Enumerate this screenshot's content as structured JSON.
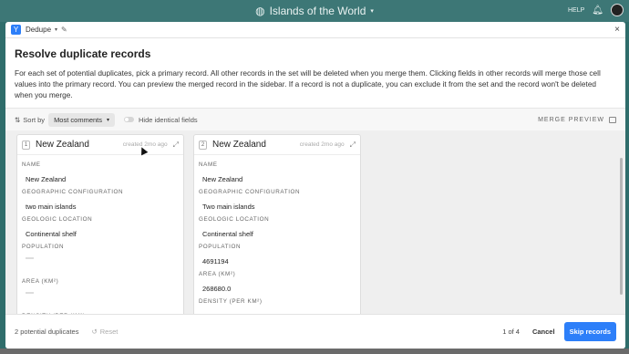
{
  "app": {
    "base_title": "Islands of the World",
    "help_label": "HELP",
    "icons": {
      "globe": "globe-icon",
      "bell": "bell-icon",
      "avatar": "avatar"
    }
  },
  "modal": {
    "app_name": "Dedupe",
    "caret": "▾",
    "close": "×",
    "title": "Resolve duplicate records",
    "description": "For each set of potential duplicates, pick a primary record. All other records in the set will be deleted when you merge them. Clicking fields in other records will merge those cell values into the primary record. You can preview the merged record in the sidebar. If a record is not a duplicate, you can exclude it from the set and the record won't be deleted when you merge."
  },
  "toolbar": {
    "sort_label": "Sort by",
    "sort_value": "Most comments",
    "hide_identical": "Hide identical fields",
    "merge_preview": "MERGE PREVIEW"
  },
  "records": [
    {
      "index": "1",
      "name": "New Zealand",
      "created": "created 2mo ago",
      "fields": [
        {
          "label": "NAME",
          "value": "New Zealand"
        },
        {
          "label": "GEOGRAPHIC CONFIGURATION",
          "value": "two main islands"
        },
        {
          "label": "GEOLOGIC LOCATION",
          "value": "Continental shelf"
        },
        {
          "label": "POPULATION",
          "value": ""
        },
        {
          "label": "AREA (KM²)",
          "value": ""
        },
        {
          "label": "DENSITY (PER KM²)",
          "value": ""
        }
      ]
    },
    {
      "index": "2",
      "name": "New Zealand",
      "created": "created 2mo ago",
      "fields": [
        {
          "label": "NAME",
          "value": "New Zealand"
        },
        {
          "label": "GEOGRAPHIC CONFIGURATION",
          "value": "Two main islands"
        },
        {
          "label": "GEOLOGIC LOCATION",
          "value": "Continental shelf"
        },
        {
          "label": "POPULATION",
          "value": "4691194"
        },
        {
          "label": "AREA (KM²)",
          "value": "268680.0"
        },
        {
          "label": "DENSITY (PER KM²)",
          "value": ""
        }
      ]
    }
  ],
  "footer": {
    "count": "2 potential duplicates",
    "reset": "Reset",
    "pager": "1 of 4",
    "cancel": "Cancel",
    "skip": "Skip records"
  },
  "colors": {
    "accent": "#2d7ff9",
    "base_bar": "#3d7776"
  }
}
